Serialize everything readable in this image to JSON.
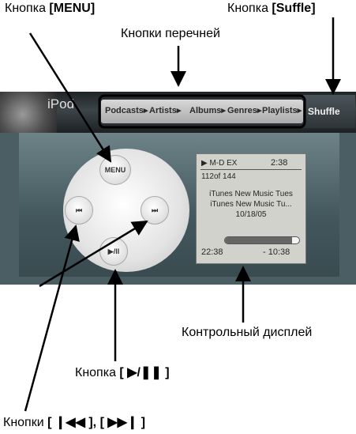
{
  "callouts": {
    "menu_prefix": "Кнопка",
    "menu_bold": "[MENU]",
    "shuffle_prefix": "Кнопка",
    "shuffle_bold": "[Suffle]",
    "lists": "Кнопки перечней",
    "display": "Контрольный дисплей",
    "play_prefix": "Кнопка",
    "play_bold": "[ ▶/❚❚ ]",
    "skip_prefix": "Кнопки",
    "skip_bold": "[ ❙◀◀ ], [ ▶▶❙ ]"
  },
  "header": {
    "ipod_text": "iPod",
    "categories": [
      "Podcasts▸",
      "Artists▸",
      "Albums▸",
      "Genres▸",
      "Playlists▸"
    ],
    "shuffle_label": "Shuffle"
  },
  "wheel": {
    "menu_label": "MENU",
    "prev_symbol": "⏮",
    "next_symbol": "⏭",
    "play_symbol": "▶/II"
  },
  "display": {
    "status": "▶ M-D EX",
    "time": "2:38",
    "track_count": "112of 144",
    "line1": "iTunes New Music Tues",
    "line2": "iTunes New Music Tu...",
    "date": "10/18/05",
    "elapsed": "22:38",
    "remaining": "- 10:38",
    "progress_fraction": 0.9
  },
  "colors": {
    "strip": "#4a5e63",
    "arrow": "#000000",
    "screen": "#d2d2cd"
  }
}
